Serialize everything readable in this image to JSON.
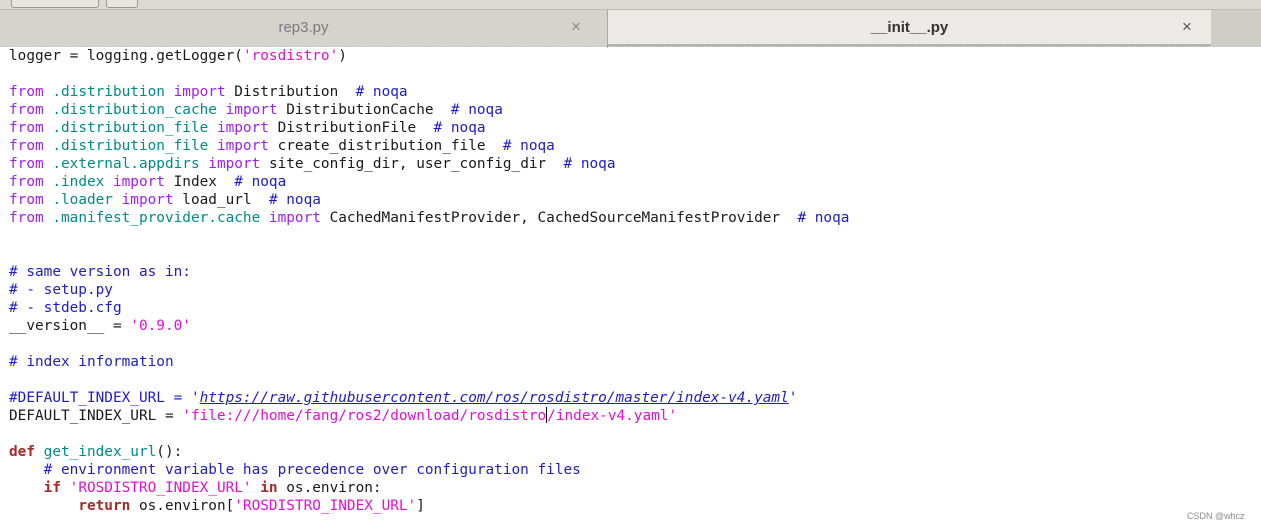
{
  "window": {
    "tabs": [
      {
        "label": "rep3.py",
        "close": "×",
        "active": false
      },
      {
        "label": "__init__.py",
        "close": "×",
        "active": true
      }
    ]
  },
  "editor": {
    "lines": [
      [
        {
          "t": "logger = logging.getLogger(",
          "c": "plain"
        },
        {
          "t": "'rosdistro'",
          "c": "str"
        },
        {
          "t": ")",
          "c": "plain"
        }
      ],
      [],
      [
        {
          "t": "from ",
          "c": "kw"
        },
        {
          "t": ".distribution",
          "c": "mod"
        },
        {
          "t": " import ",
          "c": "kw"
        },
        {
          "t": "Distribution  ",
          "c": "plain"
        },
        {
          "t": "# noqa",
          "c": "cm"
        }
      ],
      [
        {
          "t": "from ",
          "c": "kw"
        },
        {
          "t": ".distribution_cache",
          "c": "mod"
        },
        {
          "t": " import ",
          "c": "kw"
        },
        {
          "t": "DistributionCache  ",
          "c": "plain"
        },
        {
          "t": "# noqa",
          "c": "cm"
        }
      ],
      [
        {
          "t": "from ",
          "c": "kw"
        },
        {
          "t": ".distribution_file",
          "c": "mod"
        },
        {
          "t": " import ",
          "c": "kw"
        },
        {
          "t": "DistributionFile  ",
          "c": "plain"
        },
        {
          "t": "# noqa",
          "c": "cm"
        }
      ],
      [
        {
          "t": "from ",
          "c": "kw"
        },
        {
          "t": ".distribution_file",
          "c": "mod"
        },
        {
          "t": " import ",
          "c": "kw"
        },
        {
          "t": "create_distribution_file  ",
          "c": "plain"
        },
        {
          "t": "# noqa",
          "c": "cm"
        }
      ],
      [
        {
          "t": "from ",
          "c": "kw"
        },
        {
          "t": ".external.appdirs",
          "c": "mod"
        },
        {
          "t": " import ",
          "c": "kw"
        },
        {
          "t": "site_config_dir, user_config_dir  ",
          "c": "plain"
        },
        {
          "t": "# noqa",
          "c": "cm"
        }
      ],
      [
        {
          "t": "from ",
          "c": "kw"
        },
        {
          "t": ".index",
          "c": "mod"
        },
        {
          "t": " import ",
          "c": "kw"
        },
        {
          "t": "Index  ",
          "c": "plain"
        },
        {
          "t": "# noqa",
          "c": "cm"
        }
      ],
      [
        {
          "t": "from ",
          "c": "kw"
        },
        {
          "t": ".loader",
          "c": "mod"
        },
        {
          "t": " import ",
          "c": "kw"
        },
        {
          "t": "load_url  ",
          "c": "plain"
        },
        {
          "t": "# noqa",
          "c": "cm"
        }
      ],
      [
        {
          "t": "from ",
          "c": "kw"
        },
        {
          "t": ".manifest_provider.cache",
          "c": "mod"
        },
        {
          "t": " import ",
          "c": "kw"
        },
        {
          "t": "CachedManifestProvider, CachedSourceManifestProvider  ",
          "c": "plain"
        },
        {
          "t": "# noqa",
          "c": "cm"
        }
      ],
      [],
      [],
      [
        {
          "t": "# same version as in:",
          "c": "cm"
        }
      ],
      [
        {
          "t": "# - setup.py",
          "c": "cm"
        }
      ],
      [
        {
          "t": "# - stdeb.cfg",
          "c": "cm"
        }
      ],
      [
        {
          "t": "__version__ = ",
          "c": "plain"
        },
        {
          "t": "'0.9.0'",
          "c": "str"
        }
      ],
      [],
      [
        {
          "t": "# index information",
          "c": "cm"
        }
      ],
      [],
      [
        {
          "t": "#DEFAULT_INDEX_URL = '",
          "c": "cm"
        },
        {
          "t": "https://raw.githubusercontent.com/ros/rosdistro/master/index-v4.yaml",
          "c": "url"
        },
        {
          "t": "'",
          "c": "cm"
        }
      ],
      [
        {
          "t": "DEFAULT_INDEX_URL = ",
          "c": "plain"
        },
        {
          "t": "'file:///home/fang/ros2/download/rosdistro",
          "c": "str"
        },
        {
          "t": "",
          "c": "caret"
        },
        {
          "t": "/index-v4.yaml'",
          "c": "str"
        }
      ],
      [],
      [
        {
          "t": "def ",
          "c": "kwb"
        },
        {
          "t": "get_index_url",
          "c": "fn"
        },
        {
          "t": "():",
          "c": "plain"
        }
      ],
      [
        {
          "t": "    ",
          "c": "plain"
        },
        {
          "t": "# environment variable has precedence over configuration files",
          "c": "cm"
        }
      ],
      [
        {
          "t": "    ",
          "c": "plain"
        },
        {
          "t": "if ",
          "c": "kwb"
        },
        {
          "t": "'ROSDISTRO_INDEX_URL'",
          "c": "str"
        },
        {
          "t": " in ",
          "c": "kwb"
        },
        {
          "t": "os.environ:",
          "c": "plain"
        }
      ],
      [
        {
          "t": "        ",
          "c": "plain"
        },
        {
          "t": "return ",
          "c": "kwb"
        },
        {
          "t": "os.environ[",
          "c": "plain"
        },
        {
          "t": "'ROSDISTRO_INDEX_URL'",
          "c": "str"
        },
        {
          "t": "]",
          "c": "plain"
        }
      ]
    ]
  },
  "watermark": "CSDN @whcz"
}
